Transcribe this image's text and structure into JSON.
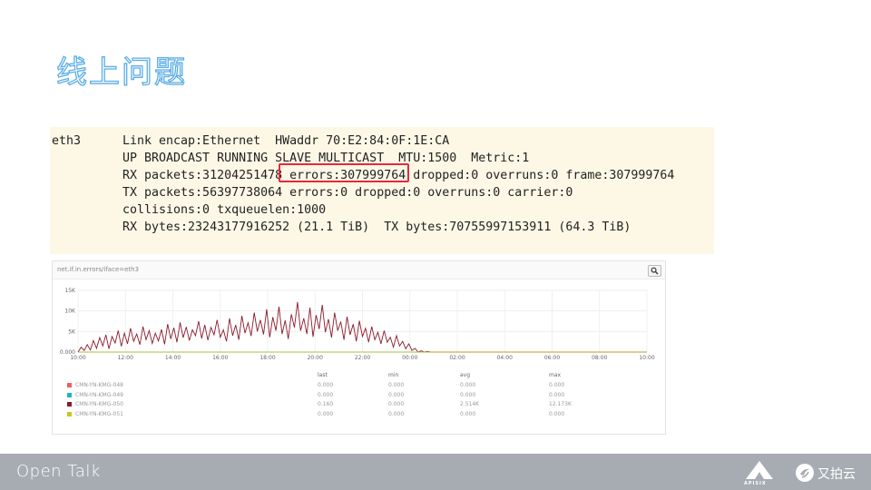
{
  "slide": {
    "title": "线上问题"
  },
  "terminal": {
    "iface": "eth3",
    "lines": [
      "Link encap:Ethernet  HWaddr 70:E2:84:0F:1E:CA",
      "UP BROADCAST RUNNING SLAVE MULTICAST  MTU:1500  Metric:1",
      "RX packets:31204251478 errors:307999764 dropped:0 overruns:0 frame:307999764",
      "TX packets:56397738064 errors:0 dropped:0 overruns:0 carrier:0",
      "collisions:0 txqueuelen:1000",
      "RX bytes:23243177916252 (21.1 TiB)  TX bytes:70755997153911 (64.3 TiB)"
    ]
  },
  "graph": {
    "title": "net.if.in.errors/iface=eth3",
    "zoom_icon": "magnifier-icon"
  },
  "chart_data": {
    "type": "line",
    "ylim": [
      0,
      15000
    ],
    "y_ticks": [
      "15K",
      "10K",
      "5K",
      "0.000"
    ],
    "x_ticks": [
      "10:00",
      "12:00",
      "14:00",
      "16:00",
      "18:00",
      "20:00",
      "22:00",
      "00:00",
      "02:00",
      "04:00",
      "06:00",
      "08:00",
      "10:00"
    ],
    "grid": true,
    "series": [
      {
        "name": "CMN-YN-KMG-048",
        "color": "#f25c5c",
        "last": "0.000",
        "min": "0.000",
        "avg": "0.000",
        "max": "0.000"
      },
      {
        "name": "CMN-YN-KMG-049",
        "color": "#20b2c8",
        "last": "0.000",
        "min": "0.000",
        "avg": "0.000",
        "max": "0.000"
      },
      {
        "name": "CMN-YN-KMG-050",
        "color": "#8b1a2a",
        "last": "0.160",
        "min": "0.000",
        "avg": "2.514K",
        "max": "12.173K",
        "values": [
          0,
          1200,
          400,
          1800,
          500,
          2800,
          900,
          3500,
          1500,
          4200,
          800,
          3800,
          2200,
          5200,
          1400,
          4600,
          2000,
          5800,
          2600,
          4400,
          1800,
          6200,
          3000,
          5200,
          2100,
          4600,
          2700,
          5500,
          1900,
          6800,
          3200,
          5900,
          2400,
          7200,
          3500,
          6100,
          2800,
          5400,
          4000,
          7500,
          3300,
          6600,
          2900,
          6000,
          4200,
          7800,
          3600,
          5400,
          2600,
          8200,
          4000,
          6600,
          3000,
          8800,
          4600,
          7100,
          3900,
          9600,
          5000,
          7800,
          4300,
          10400,
          3600,
          8500,
          5200,
          11000,
          4400,
          7700,
          3200,
          9200,
          6000,
          12173,
          5200,
          8200,
          4400,
          10800,
          3700,
          9000,
          5600,
          11500,
          4800,
          8000,
          3500,
          9600,
          5200,
          7400,
          3000,
          8600,
          4200,
          6800,
          2600,
          7600,
          3800,
          5800,
          2400,
          6200,
          3000,
          4800,
          2000,
          5200,
          2400,
          3600,
          1200,
          4000,
          1500,
          2600,
          800,
          2000,
          400,
          900,
          0,
          300,
          0,
          150,
          0,
          0,
          0,
          0,
          0,
          0,
          0,
          0,
          0,
          0,
          0,
          0,
          0,
          0,
          0,
          0,
          0,
          0,
          0,
          0,
          0,
          0,
          0,
          0,
          0,
          0,
          0,
          0,
          0,
          0,
          0,
          0,
          0,
          0,
          0,
          0,
          0,
          0,
          0,
          0,
          0,
          0,
          0,
          0,
          0,
          0,
          0,
          0,
          0,
          0,
          0,
          0,
          0,
          0,
          0,
          0,
          0,
          0,
          0,
          0,
          0,
          0,
          0,
          0,
          0,
          0,
          0,
          0,
          0,
          0,
          0.16
        ]
      },
      {
        "name": "CMN-YN-KMG-051",
        "color": "#c8c81e",
        "last": "0.000",
        "min": "0.000",
        "avg": "0.000",
        "max": "0.000"
      }
    ],
    "stat_headers": {
      "last": "last",
      "min": "min",
      "avg": "avg",
      "max": "max"
    }
  },
  "footer": {
    "brand": "Open Talk",
    "apisix_label": "APISIX",
    "upyun_label": "又拍云"
  }
}
